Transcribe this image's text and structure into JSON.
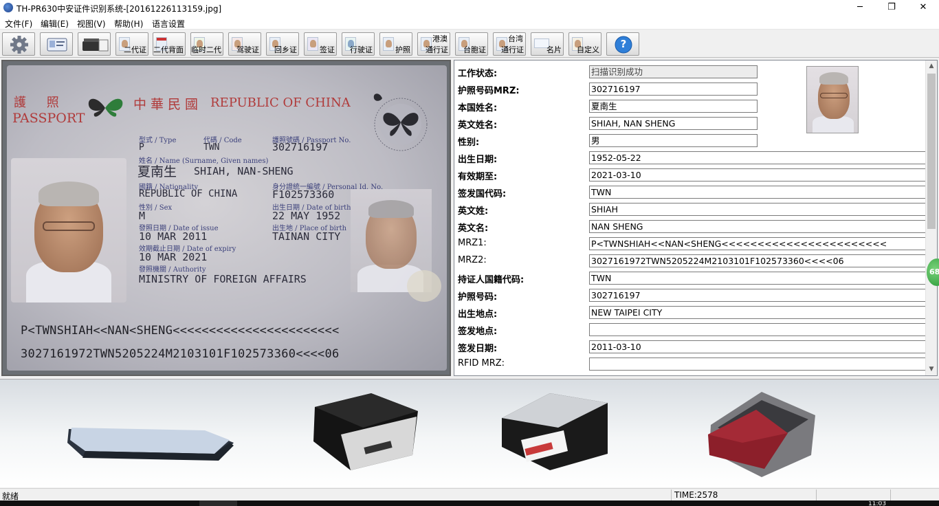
{
  "window": {
    "title": "TH-PR630中安证件识别系统-[20161226113159.jpg]",
    "minimize": "─",
    "restore": "❐",
    "close": "✕"
  },
  "menu": [
    "文件(F)",
    "编辑(E)",
    "视图(V)",
    "帮助(H)",
    "语言设置"
  ],
  "toolbar": {
    "buttons": [
      {
        "label": "",
        "icon": "gear-icon"
      },
      {
        "label": "",
        "icon": "scan-card-icon"
      },
      {
        "label": "",
        "icon": "scanner-icon"
      },
      {
        "label": "二代证",
        "icon": "id-card-icon"
      },
      {
        "label": "二代背面",
        "icon": "id-card-back-icon"
      },
      {
        "label": "临时二代",
        "icon": "temp-id-icon"
      },
      {
        "label": "驾驶证",
        "icon": "driver-license-icon"
      },
      {
        "label": "回乡证",
        "icon": "home-return-permit-icon"
      },
      {
        "label": "签证",
        "icon": "visa-icon"
      },
      {
        "label": "行驶证",
        "icon": "vehicle-license-icon"
      },
      {
        "label": "护照",
        "icon": "passport-icon"
      },
      {
        "label": "通行证",
        "top_label": "港澳",
        "icon": "hk-macau-permit-icon"
      },
      {
        "label": "台胞证",
        "icon": "taiwan-compatriot-icon"
      },
      {
        "label": "通行证",
        "top_label": "台湾",
        "icon": "taiwan-permit-icon"
      },
      {
        "label": "名片",
        "icon": "business-card-icon"
      },
      {
        "label": "自定义",
        "icon": "custom-icon"
      },
      {
        "label": "?",
        "icon": "help-icon"
      }
    ]
  },
  "passport_image": {
    "header_cn": "護  照",
    "header_en": "PASSPORT",
    "country_cn": "中華民國",
    "country_en": "REPUBLIC OF CHINA",
    "type_label": "型式 / Type",
    "type_value": "P",
    "code_label": "代碼 / Code",
    "code_value": "TWN",
    "passport_no_label": "護照號碼 / Passport No.",
    "passport_no_value": "302716197",
    "name_label": "姓名 / Name (Surname, Given names)",
    "name_cn": "夏南生",
    "name_en": "SHIAH, NAN-SHENG",
    "nationality_label": "國籍 / Nationality",
    "nationality_value": "REPUBLIC OF CHINA",
    "personal_id_label": "身分證統一編號 / Personal Id. No.",
    "personal_id_value": "F102573360",
    "sex_label": "性別 / Sex",
    "sex_value": "M",
    "dob_label": "出生日期 / Date of birth",
    "dob_value": "22 MAY 1952",
    "issue_label": "發照日期 / Date of issue",
    "issue_value": "10 MAR 2011",
    "pob_label": "出生地 / Place of birth",
    "pob_value": "TAINAN CITY",
    "expiry_label": "效期截止日期 / Date of expiry",
    "expiry_value": "10 MAR 2021",
    "authority_label": "發照機關 / Authority",
    "authority_value": "MINISTRY OF FOREIGN AFFAIRS",
    "mrz1": "P<TWNSHIAH<<NAN<SHENG<<<<<<<<<<<<<<<<<<<<<<<",
    "mrz2": "3027161972TWN5205224M2103101F102573360<<<<06"
  },
  "results": [
    {
      "label": "工作状态:",
      "value": "扫描识别成功",
      "status": true
    },
    {
      "label": "护照号码MRZ:",
      "value": "302716197"
    },
    {
      "label": "本国姓名:",
      "value": "夏南生"
    },
    {
      "label": "英文姓名:",
      "value": "SHIAH, NAN SHENG"
    },
    {
      "label": "性别:",
      "value": "男"
    },
    {
      "label": "出生日期:",
      "value": "1952-05-22"
    },
    {
      "label": "有效期至:",
      "value": "2021-03-10"
    },
    {
      "label": "签发国代码:",
      "value": "TWN"
    },
    {
      "label": "英文姓:",
      "value": "SHIAH"
    },
    {
      "label": "英文名:",
      "value": "NAN SHENG"
    },
    {
      "label": "MRZ1:",
      "value": "P<TWNSHIAH<<NAN<SHENG<<<<<<<<<<<<<<<<<<<<<<<",
      "light": true
    },
    {
      "label": "MRZ2:",
      "value": "3027161972TWN5205224M2103101F102573360<<<<06",
      "light": true
    },
    {
      "label": "持证人国籍代码:",
      "value": "TWN"
    },
    {
      "label": "护照号码:",
      "value": "302716197"
    },
    {
      "label": "出生地点:",
      "value": "NEW TAIPEI CITY"
    },
    {
      "label": "签发地点:",
      "value": ""
    },
    {
      "label": "签发日期:",
      "value": "2011-03-10"
    },
    {
      "label": "RFID MRZ:",
      "value": "",
      "light": true
    }
  ],
  "float_badge": "68",
  "status": {
    "left": "就绪",
    "time": "TIME:2578"
  },
  "taskbar": {
    "clock": "11:03"
  }
}
